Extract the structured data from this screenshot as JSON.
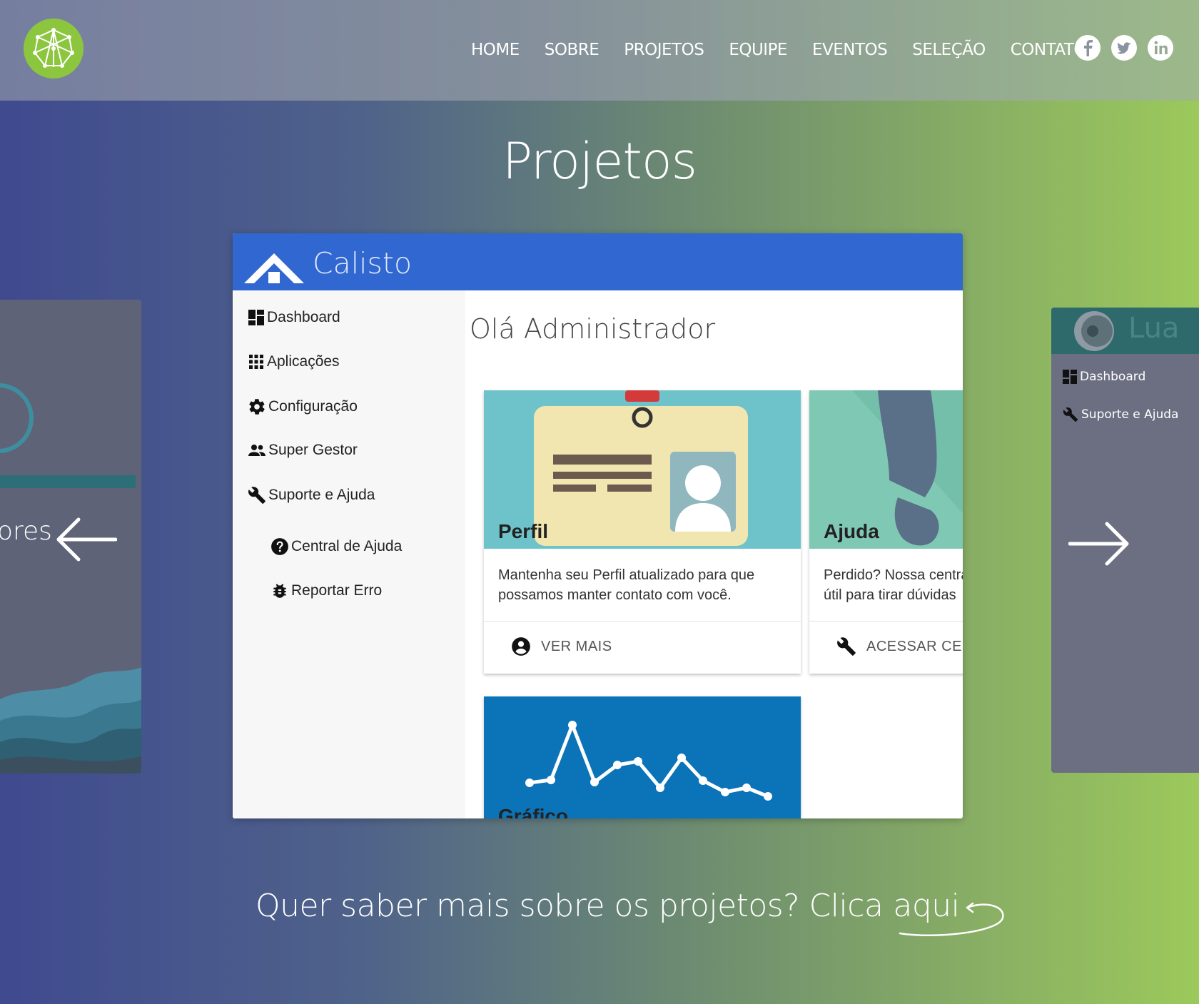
{
  "nav": {
    "items": [
      "HOME",
      "SOBRE",
      "PROJETOS",
      "EQUIPE",
      "EVENTOS",
      "SELEÇÃO",
      "CONTATO"
    ]
  },
  "social": [
    "facebook-icon",
    "twitter-icon",
    "linkedin-icon"
  ],
  "section": {
    "title": "Projetos"
  },
  "carousel": {
    "left_peek_text": "ores",
    "right_card": {
      "title": "Lua",
      "items": [
        "Dashboard",
        "Suporte e Ajuda"
      ]
    }
  },
  "app": {
    "title": "Calisto",
    "greeting": "Olá Administrador",
    "sidebar": [
      "Dashboard",
      "Aplicações",
      "Configuração",
      "Super Gestor",
      "Suporte e Ajuda"
    ],
    "subitems": [
      "Central de Ajuda",
      "Reportar Erro"
    ],
    "tiles": [
      {
        "title": "Perfil",
        "desc": "Mantenha seu Perfil atualizado para que\npossamos manter contato com você.",
        "action": "VER MAIS"
      },
      {
        "title": "Ajuda",
        "desc": "Perdido? Nossa centra\nútil para tirar dúvidas",
        "action": "ACESSAR CEN"
      },
      {
        "title": "Gráfico"
      }
    ]
  },
  "cta": {
    "text": "Quer saber mais sobre os projetos? Clica",
    "link": "aqui"
  },
  "colors": {
    "accent_green": "#8cc63f",
    "app_blue": "#3167d0",
    "tile_teal": "#6ec3cb",
    "tile_green": "#7fc9b4",
    "tile_blue": "#0b73b8"
  }
}
